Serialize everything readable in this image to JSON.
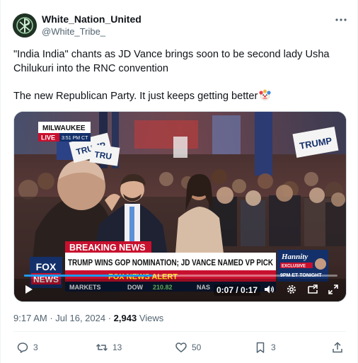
{
  "author": {
    "display_name": "White_Nation_United",
    "handle": "@White_Tribe_"
  },
  "tweet": {
    "line1": "\"India India\" chants as JD Vance brings soon to be second lady Usha Chilukuri into the RNC convention",
    "line2": "The new Republican Party. It just keeps getting better",
    "emoji": "clown-face"
  },
  "video": {
    "location_tag": "MILWAUKEE",
    "live_label": "LIVE",
    "live_time": "3:51 PM CT",
    "sign_left": "TRUMP",
    "sign_left_2": "TRU",
    "sign_right": "TRUMP",
    "breaking_label": "BREAKING NEWS",
    "headline": "TRUMP WINS GOP NOMINATION; JD VANCE NAMED VP PICK",
    "alert_label": "FOX NEWS ALERT",
    "network_logo_1": "FOX",
    "network_logo_2": "NEWS",
    "promo_show": "Hannity",
    "promo_badge": "EXCLUSIVE",
    "promo_time": "9PM ET TONIGHT",
    "ticker_markets": "MARKETS",
    "ticker_dow": "DOW",
    "ticker_value": "210.82",
    "ticker_nas": "NAS",
    "time_display": "0:07 / 0:17",
    "progress": 0.41
  },
  "meta": {
    "time": "9:17 AM",
    "date": "Jul 16, 2024",
    "separator": " · ",
    "views_count": "2,943",
    "views_label": " Views"
  },
  "actions": {
    "replies": "3",
    "reposts": "13",
    "likes": "50",
    "bookmarks": "3"
  },
  "colors": {
    "fox_red": "#c8102e",
    "fox_blue": "#13306a",
    "accent_text": "#536471"
  }
}
